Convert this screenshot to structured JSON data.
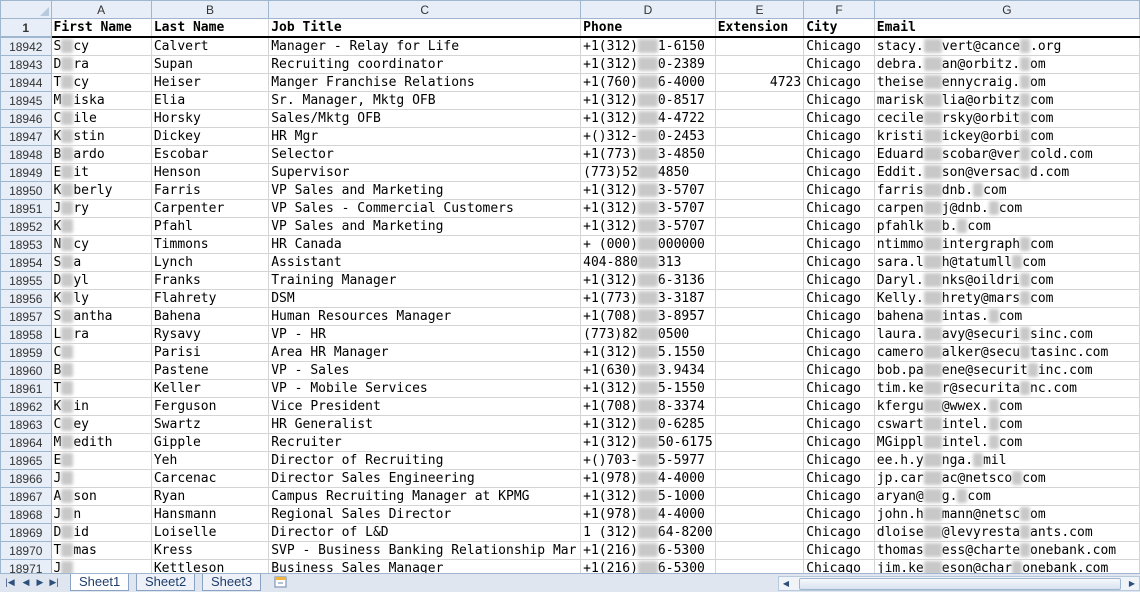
{
  "columns": [
    "A",
    "B",
    "C",
    "D",
    "E",
    "F",
    "G"
  ],
  "header_row": {
    "row_number": "1",
    "cells": [
      "First Name",
      "Last Name",
      "Job Title",
      "Phone",
      "Extension",
      "City",
      "Email"
    ]
  },
  "rows": [
    {
      "n": "18942",
      "first": "S",
      "first_tail": "cy",
      "last": "Calvert",
      "title": "Manager - Relay for Life",
      "phone_a": "+1(312)",
      "phone_b": "1-6150",
      "ext": "",
      "city": "Chicago",
      "email_a": "stacy.",
      "email_b": "vert@cance",
      "email_c": ".org"
    },
    {
      "n": "18943",
      "first": "D",
      "first_tail": "ra",
      "last": "Supan",
      "title": "Recruiting coordinator",
      "phone_a": "+1(312)",
      "phone_b": "0-2389",
      "ext": "",
      "city": "Chicago",
      "email_a": "debra.",
      "email_b": "an@orbitz.",
      "email_c": "om"
    },
    {
      "n": "18944",
      "first": "T",
      "first_tail": "cy",
      "last": "Heiser",
      "title": "Manger Franchise Relations",
      "phone_a": "+1(760)",
      "phone_b": "6-4000",
      "ext": "4723",
      "city": "Chicago",
      "email_a": "theise",
      "email_b": "ennycraig.",
      "email_c": "om"
    },
    {
      "n": "18945",
      "first": "M",
      "first_tail": "iska",
      "last": "Elia",
      "title": "Sr. Manager, Mktg OFB",
      "phone_a": "+1(312)",
      "phone_b": "0-8517",
      "ext": "",
      "city": "Chicago",
      "email_a": "marisk",
      "email_b": "lia@orbitz",
      "email_c": "com"
    },
    {
      "n": "18946",
      "first": "C",
      "first_tail": "ile",
      "last": "Horsky",
      "title": "Sales/Mktg OFB",
      "phone_a": "+1(312)",
      "phone_b": "4-4722",
      "ext": "",
      "city": "Chicago",
      "email_a": "cecile",
      "email_b": "rsky@orbit",
      "email_c": "com"
    },
    {
      "n": "18947",
      "first": "K",
      "first_tail": "stin",
      "last": "Dickey",
      "title": "HR Mgr",
      "phone_a": "+()312-",
      "phone_b": "0-2453",
      "ext": "",
      "city": "Chicago",
      "email_a": "kristi",
      "email_b": "ickey@orbi",
      "email_c": "com"
    },
    {
      "n": "18948",
      "first": "B",
      "first_tail": "ardo",
      "last": "Escobar",
      "title": "Selector",
      "phone_a": "+1(773)",
      "phone_b": "3-4850",
      "ext": "",
      "city": "Chicago",
      "email_a": "Eduard",
      "email_b": "scobar@ver",
      "email_c": "cold.com"
    },
    {
      "n": "18949",
      "first": "E",
      "first_tail": "it",
      "last": "Henson",
      "title": "Supervisor",
      "phone_a": "(773)52",
      "phone_b": "4850",
      "ext": "",
      "city": "Chicago",
      "email_a": "Eddit.",
      "email_b": "son@versac",
      "email_c": "d.com"
    },
    {
      "n": "18950",
      "first": "K",
      "first_tail": "berly",
      "last": "Farris",
      "title": "VP Sales and Marketing",
      "phone_a": "+1(312)",
      "phone_b": "3-5707",
      "ext": "",
      "city": "Chicago",
      "email_a": "farris",
      "email_b": "dnb.",
      "email_c": "com"
    },
    {
      "n": "18951",
      "first": "J",
      "first_tail": "ry",
      "last": "Carpenter",
      "title": "VP Sales - Commercial Customers",
      "phone_a": "+1(312)",
      "phone_b": "3-5707",
      "ext": "",
      "city": "Chicago",
      "email_a": "carpen",
      "email_b": "j@dnb.",
      "email_c": "com"
    },
    {
      "n": "18952",
      "first": "K",
      "first_tail": "",
      "last": "Pfahl",
      "title": "VP Sales and Marketing",
      "phone_a": "+1(312)",
      "phone_b": "3-5707",
      "ext": "",
      "city": "Chicago",
      "email_a": "pfahlk",
      "email_b": "b.",
      "email_c": "com"
    },
    {
      "n": "18953",
      "first": "N",
      "first_tail": "cy",
      "last": "Timmons",
      "title": "HR Canada",
      "phone_a": "+ (000)",
      "phone_b": "000000",
      "ext": "",
      "city": "Chicago",
      "email_a": "ntimmo",
      "email_b": "intergraph",
      "email_c": "com"
    },
    {
      "n": "18954",
      "first": "S",
      "first_tail": "a",
      "last": "Lynch",
      "title": "Assistant",
      "phone_a": "404-880",
      "phone_b": "313",
      "ext": "",
      "city": "Chicago",
      "email_a": "sara.l",
      "email_b": "h@tatumll",
      "email_c": "com"
    },
    {
      "n": "18955",
      "first": "D",
      "first_tail": "yl",
      "last": "Franks",
      "title": "Training Manager",
      "phone_a": "+1(312)",
      "phone_b": "6-3136",
      "ext": "",
      "city": "Chicago",
      "email_a": "Daryl.",
      "email_b": "nks@oildri",
      "email_c": "com"
    },
    {
      "n": "18956",
      "first": "K",
      "first_tail": "ly",
      "last": "Flahrety",
      "title": "DSM",
      "phone_a": "+1(773)",
      "phone_b": "3-3187",
      "ext": "",
      "city": "Chicago",
      "email_a": "Kelly.",
      "email_b": "hrety@mars",
      "email_c": "com"
    },
    {
      "n": "18957",
      "first": "S",
      "first_tail": "antha",
      "last": "Bahena",
      "title": "Human Resources Manager",
      "phone_a": "+1(708)",
      "phone_b": "3-8957",
      "ext": "",
      "city": "Chicago",
      "email_a": "bahena",
      "email_b": "intas.",
      "email_c": "com"
    },
    {
      "n": "18958",
      "first": "L",
      "first_tail": "ra",
      "last": "Rysavy",
      "title": "VP - HR",
      "phone_a": "(773)82",
      "phone_b": "0500",
      "ext": "",
      "city": "Chicago",
      "email_a": "laura.",
      "email_b": "avy@securi",
      "email_c": "sinc.com"
    },
    {
      "n": "18959",
      "first": "C",
      "first_tail": "",
      "last": "Parisi",
      "title": "Area HR Manager",
      "phone_a": "+1(312)",
      "phone_b": "5.1550",
      "ext": "",
      "city": "Chicago",
      "email_a": "camero",
      "email_b": "alker@secu",
      "email_c": "tasinc.com"
    },
    {
      "n": "18960",
      "first": "B",
      "first_tail": "",
      "last": "Pastene",
      "title": "VP - Sales",
      "phone_a": "+1(630)",
      "phone_b": "3.9434",
      "ext": "",
      "city": "Chicago",
      "email_a": "bob.pa",
      "email_b": "ene@securit",
      "email_c": "inc.com"
    },
    {
      "n": "18961",
      "first": "T",
      "first_tail": "",
      "last": "Keller",
      "title": "VP - Mobile Services",
      "phone_a": "+1(312)",
      "phone_b": "5-1550",
      "ext": "",
      "city": "Chicago",
      "email_a": "tim.ke",
      "email_b": "r@securita",
      "email_c": "nc.com"
    },
    {
      "n": "18962",
      "first": "K",
      "first_tail": "in",
      "last": "Ferguson",
      "title": "Vice President",
      "phone_a": "+1(708)",
      "phone_b": "8-3374",
      "ext": "",
      "city": "Chicago",
      "email_a": "kfergu",
      "email_b": "@wwex.",
      "email_c": "com"
    },
    {
      "n": "18963",
      "first": "C",
      "first_tail": "ey",
      "last": "Swartz",
      "title": "HR Generalist",
      "phone_a": "+1(312)",
      "phone_b": "0-6285",
      "ext": "",
      "city": "Chicago",
      "email_a": "cswart",
      "email_b": "intel.",
      "email_c": "com"
    },
    {
      "n": "18964",
      "first": "M",
      "first_tail": "edith",
      "last": "Gipple",
      "title": "Recruiter",
      "phone_a": "+1(312)",
      "phone_b": "50-6175",
      "ext": "",
      "city": "Chicago",
      "email_a": "MGippl",
      "email_b": "intel.",
      "email_c": "com"
    },
    {
      "n": "18965",
      "first": "E",
      "first_tail": "",
      "last": "Yeh",
      "title": "Director of Recruiting",
      "phone_a": "+()703-",
      "phone_b": "5-5977",
      "ext": "",
      "city": "Chicago",
      "email_a": "ee.h.y",
      "email_b": "nga.",
      "email_c": "mil"
    },
    {
      "n": "18966",
      "first": "J",
      "first_tail": "",
      "last": "Carcenac",
      "title": "Director Sales Engineering",
      "phone_a": "+1(978)",
      "phone_b": "4-4000",
      "ext": "",
      "city": "Chicago",
      "email_a": "jp.car",
      "email_b": "ac@netsco",
      "email_c": "com"
    },
    {
      "n": "18967",
      "first": "A",
      "first_tail": "son",
      "last": "Ryan",
      "title": "Campus Recruiting Manager at KPMG",
      "phone_a": "+1(312)",
      "phone_b": "5-1000",
      "ext": "",
      "city": "Chicago",
      "email_a": "aryan@",
      "email_b": "g.",
      "email_c": "com"
    },
    {
      "n": "18968",
      "first": "J",
      "first_tail": "n",
      "last": "Hansmann",
      "title": "Regional Sales Director",
      "phone_a": "+1(978)",
      "phone_b": "4-4000",
      "ext": "",
      "city": "Chicago",
      "email_a": "john.h",
      "email_b": "mann@netsc",
      "email_c": "om"
    },
    {
      "n": "18969",
      "first": "D",
      "first_tail": "id",
      "last": "Loiselle",
      "title": "Director of L&D",
      "phone_a": "1 (312)",
      "phone_b": "64-8200",
      "ext": "",
      "city": "Chicago",
      "email_a": "dloise",
      "email_b": "@levyresta",
      "email_c": "ants.com"
    },
    {
      "n": "18970",
      "first": "T",
      "first_tail": "mas",
      "last": "Kress",
      "title": "SVP - Business Banking Relationship Mar",
      "phone_a": "+1(216)",
      "phone_b": "6-5300",
      "ext": "",
      "city": "Chicago",
      "email_a": "thomas",
      "email_b": "ess@charte",
      "email_c": "onebank.com"
    },
    {
      "n": "18971",
      "first": "J",
      "first_tail": "",
      "last": "Kettleson",
      "title": "Business Sales Manager",
      "phone_a": "+1(216)",
      "phone_b": "6-5300",
      "ext": "",
      "city": "Chicago",
      "email_a": "jim.ke",
      "email_b": "eson@char",
      "email_c": "onebank.com"
    }
  ],
  "sheet_tabs": [
    "Sheet1",
    "Sheet2",
    "Sheet3"
  ],
  "active_sheet": "Sheet1",
  "icons": {
    "nav_first": "nav-first-icon",
    "nav_prev": "nav-prev-icon",
    "nav_next": "nav-next-icon",
    "nav_last": "nav-last-icon",
    "insert_sheet": "insert-sheet-icon"
  },
  "colors": {
    "header_bg": "#e8eef7",
    "grid_line": "#d4d4d4",
    "tab_text": "#1f3d6b"
  }
}
